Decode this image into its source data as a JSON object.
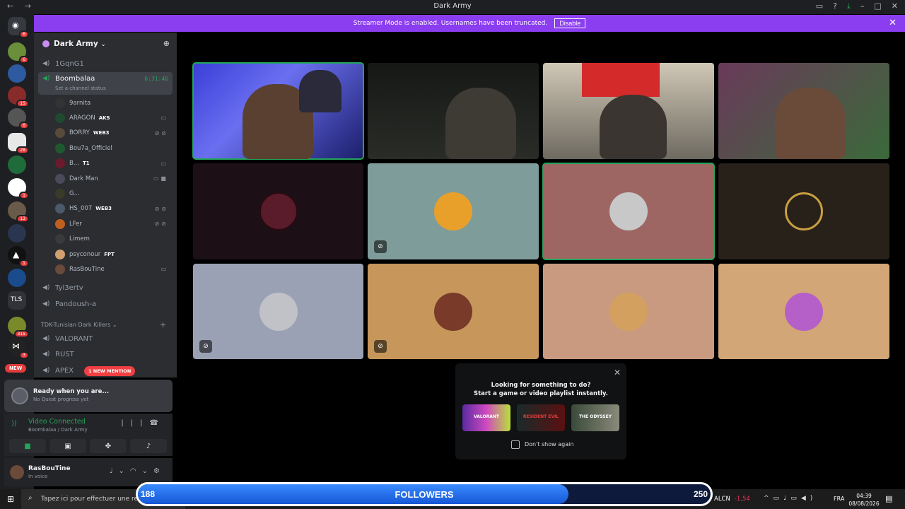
{
  "window": {
    "title": "Dark Army",
    "nav": "← →"
  },
  "banner": {
    "text": "Streamer Mode is enabled. Usernames have been truncated.",
    "disable_label": "Disable"
  },
  "server_rail": {
    "badges": [
      "6",
      "6",
      "",
      "15",
      "6",
      "28",
      "",
      "1",
      "13",
      "",
      "1",
      "",
      "315",
      "3"
    ],
    "tls_label": "TLS",
    "new_label": "NEW"
  },
  "guild": {
    "name": "Dark Army"
  },
  "channels": {
    "top": "1GqnG1",
    "active": {
      "name": "Boombalaa",
      "timer": "6:31:46",
      "status": "Set a channel status"
    },
    "users": [
      {
        "name": "9arnita",
        "tag": "",
        "icons": ""
      },
      {
        "name": "ARAGON",
        "tag": "AKS",
        "icons": "▭"
      },
      {
        "name": "BORRY",
        "tag": "WEB3",
        "icons": "⊘⊘"
      },
      {
        "name": "Bou7a_Officiel",
        "tag": "",
        "icons": ""
      },
      {
        "name": "B...",
        "tag": "T1",
        "icons": "▭"
      },
      {
        "name": "Dark Man",
        "tag": "",
        "icons": "▭■"
      },
      {
        "name": "G...",
        "tag": "",
        "icons": ""
      },
      {
        "name": "HS_007",
        "tag": "WEB3",
        "icons": "⊘⊘"
      },
      {
        "name": "LFer",
        "tag": "",
        "icons": "⊘⊘"
      },
      {
        "name": "Limem",
        "tag": "",
        "icons": ""
      },
      {
        "name": "psyconour",
        "tag": "FPT",
        "icons": ""
      },
      {
        "name": "RasBouTine",
        "tag": "",
        "icons": "▭"
      }
    ],
    "after": [
      "Tyl3ertv",
      "Pandoush-a"
    ],
    "category": "TDK-Tunisian Dark Killers",
    "category_channels": [
      "VALORANT",
      "RUST",
      "APEX"
    ],
    "mention_label": "1 NEW MENTION"
  },
  "quest": {
    "title": "Ready when you are...",
    "subtitle": "No Quest progress yet"
  },
  "voice": {
    "status": "Video Connected",
    "location": "Boombalaa / Dark Army"
  },
  "user_panel": {
    "name": "RasBouTine",
    "status": "In voice"
  },
  "popup": {
    "line1": "Looking for something to do?",
    "line2": "Start a game or video playlist instantly.",
    "thumbs": [
      "VALORANT",
      "RESIDENT EVIL",
      "THE ODYSSEY"
    ],
    "checkbox_label": "Don't show again"
  },
  "taskbar": {
    "search_placeholder": "Tapez ici pour effectuer une recherche",
    "ticker": "ALCN",
    "ticker_change": "-1,54",
    "lang": "FRA",
    "time": "04:39",
    "date": "08/08/2026"
  },
  "followers": {
    "current": "188",
    "label": "FOLLOWERS",
    "goal": "250",
    "progress_fraction": 0.752
  }
}
